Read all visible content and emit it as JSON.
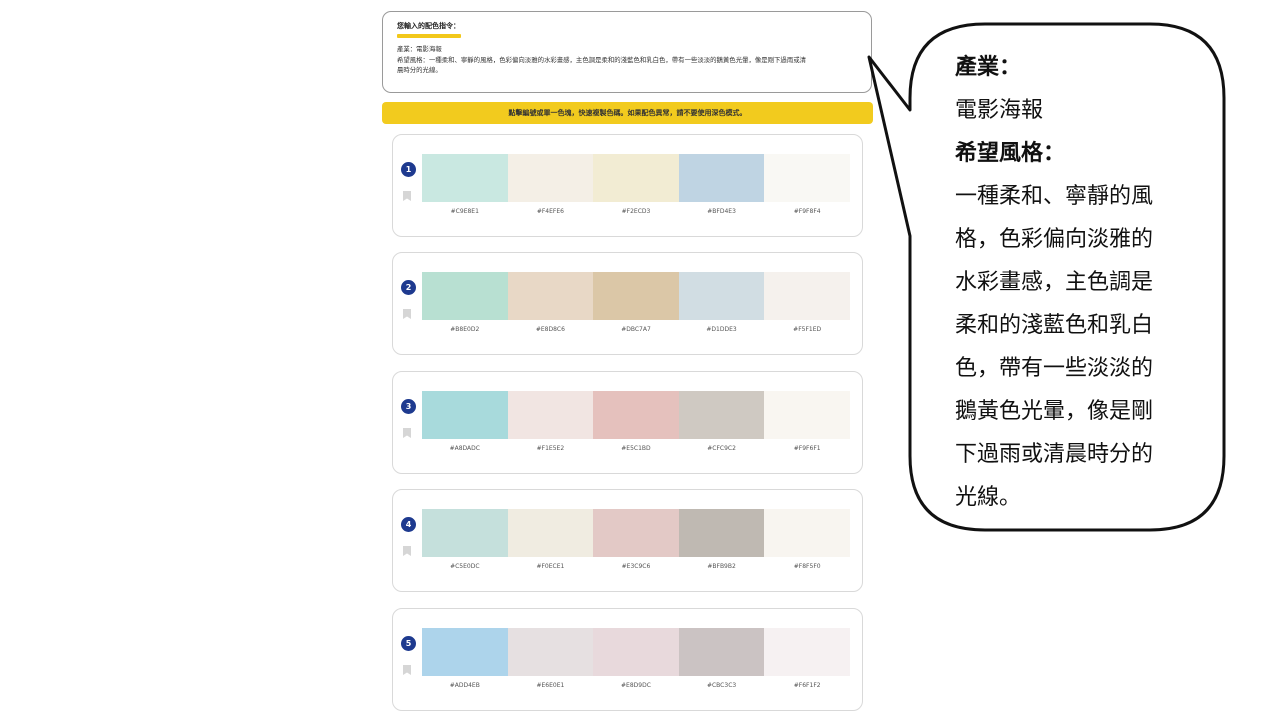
{
  "prompt_card": {
    "title": "您輸入的配色指令：",
    "industry_line": "產業：電影海報",
    "style_line_1": "希望風格：一種柔和、寧靜的風格，色彩偏向淡雅的水彩畫感，主色調是柔和的淺藍色和乳白色，帶有一些淡淡的鵝黃色光暈，像是剛下過雨或清",
    "style_line_2": "晨時分的光線。"
  },
  "tip": "點擊編號或單一色塊，快速複製色碼。如果配色異常，請不要使用深色模式。",
  "palettes": [
    {
      "number": "1",
      "colors": [
        "#C9E8E1",
        "#F4EFE6",
        "#F2ECD3",
        "#BFD4E3",
        "#F9F8F4"
      ],
      "codes": [
        "#C9E8E1",
        "#F4EFE6",
        "#F2ECD3",
        "#BFD4E3",
        "#F9F8F4"
      ]
    },
    {
      "number": "2",
      "colors": [
        "#B8E0D2",
        "#E8D8C6",
        "#DBC7A7",
        "#D1DDE3",
        "#F5F1ED"
      ],
      "codes": [
        "#B8E0D2",
        "#E8D8C6",
        "#DBC7A7",
        "#D1DDE3",
        "#F5F1ED"
      ]
    },
    {
      "number": "3",
      "colors": [
        "#A8DADC",
        "#F1E5E2",
        "#E5C1BD",
        "#CFC9C2",
        "#F9F6F1"
      ],
      "codes": [
        "#A8DADC",
        "#F1E5E2",
        "#E5C1BD",
        "#CFC9C2",
        "#F9F6F1"
      ]
    },
    {
      "number": "4",
      "colors": [
        "#C5E0DC",
        "#F0ECE1",
        "#E3C9C6",
        "#BFB9B2",
        "#F8F5F0"
      ],
      "codes": [
        "#C5E0DC",
        "#F0ECE1",
        "#E3C9C6",
        "#BFB9B2",
        "#F8F5F0"
      ]
    },
    {
      "number": "5",
      "colors": [
        "#ADD4EB",
        "#E6E0E1",
        "#E8D9DC",
        "#CBC3C3",
        "#F6F1F2"
      ],
      "codes": [
        "#ADD4EB",
        "#E6E0E1",
        "#E8D9DC",
        "#CBC3C3",
        "#F6F1F2"
      ]
    }
  ],
  "callout": {
    "industry_label": "產業：",
    "industry_value": "電影海報",
    "style_label": "希望風格：",
    "style_lines": [
      "一種柔和、寧靜的風",
      "格，色彩偏向淡雅的",
      "水彩畫感，主色調是",
      "柔和的淺藍色和乳白",
      "色，帶有一些淡淡的",
      "鵝黃色光暈，像是剛",
      "下過雨或清晨時分的",
      "光線。"
    ]
  },
  "colors": {
    "accent_yellow": "#F2CB1E",
    "badge_blue": "#1E3A8F"
  }
}
